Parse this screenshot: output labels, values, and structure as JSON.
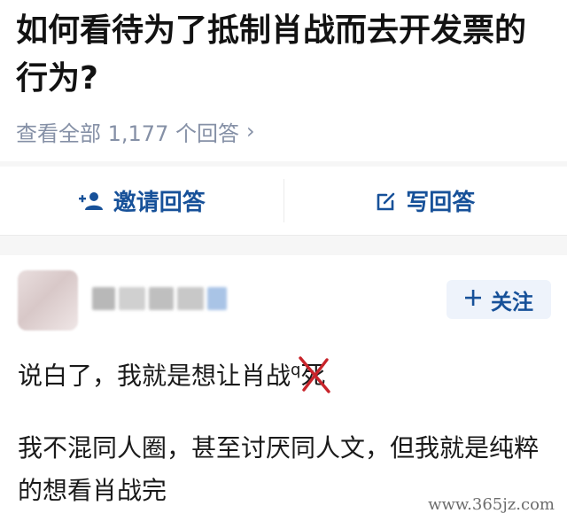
{
  "question": {
    "title": "如何看待为了抵制肖战而去开发票的行为?",
    "view_all_label": "查看全部 1,177 个回答",
    "view_all_chevron": "›"
  },
  "actions": {
    "invite_label": "邀请回答",
    "invite_icon": "add-user-icon",
    "write_label": "写回答",
    "write_icon": "edit-icon",
    "accent_color": "#175199"
  },
  "answer": {
    "follow_label": "关注",
    "follow_icon": "plus-icon",
    "line1_text": "说白了，我就是想让肖战",
    "line1_superscript": "q",
    "line1_struck_char": "死",
    "paragraph": "我不混同人圈，甚至讨厌同人文，但我就是纯粹的想看肖战完"
  },
  "watermark": "www.365jz.com"
}
